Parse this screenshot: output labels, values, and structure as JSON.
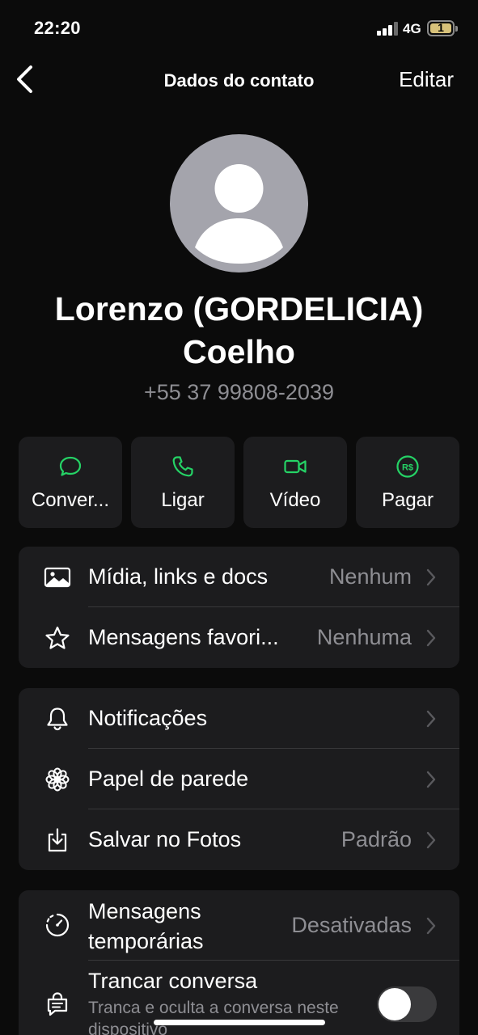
{
  "status_bar": {
    "time": "22:20",
    "network": "4G",
    "battery_level": "1"
  },
  "nav": {
    "title": "Dados do contato",
    "edit_label": "Editar"
  },
  "contact": {
    "name_line1": "Lorenzo (GORDELICIA)",
    "name_line2": "Coelho",
    "phone": "+55 37 99808-2039"
  },
  "actions": [
    {
      "label": "Conver...",
      "icon": "chat-bubble-icon"
    },
    {
      "label": "Ligar",
      "icon": "phone-icon"
    },
    {
      "label": "Vídeo",
      "icon": "video-camera-icon"
    },
    {
      "label": "Pagar",
      "icon": "real-currency-icon"
    }
  ],
  "group1": [
    {
      "label": "Mídia, links e docs",
      "value": "Nenhum",
      "icon": "image-icon"
    },
    {
      "label": "Mensagens favori...",
      "value": "Nenhuma",
      "icon": "star-icon"
    }
  ],
  "group2": [
    {
      "label": "Notificações",
      "value": "",
      "icon": "bell-icon"
    },
    {
      "label": "Papel de parede",
      "value": "",
      "icon": "flower-icon"
    },
    {
      "label": "Salvar no Fotos",
      "value": "Padrão",
      "icon": "save-download-icon"
    }
  ],
  "group3": {
    "temp_label_line1": "Mensagens",
    "temp_label_line2": "temporárias",
    "temp_value": "Desativadas",
    "lock_label": "Trancar conversa",
    "lock_sublabel_line1": "Tranca e oculta a conversa neste",
    "lock_sublabel_line2": "dispositivo",
    "lock_enabled": false
  },
  "colors": {
    "accent_green": "#25d366",
    "background": "#0b0b0b",
    "card": "#1c1c1e",
    "secondary_text": "#8e8e93"
  }
}
